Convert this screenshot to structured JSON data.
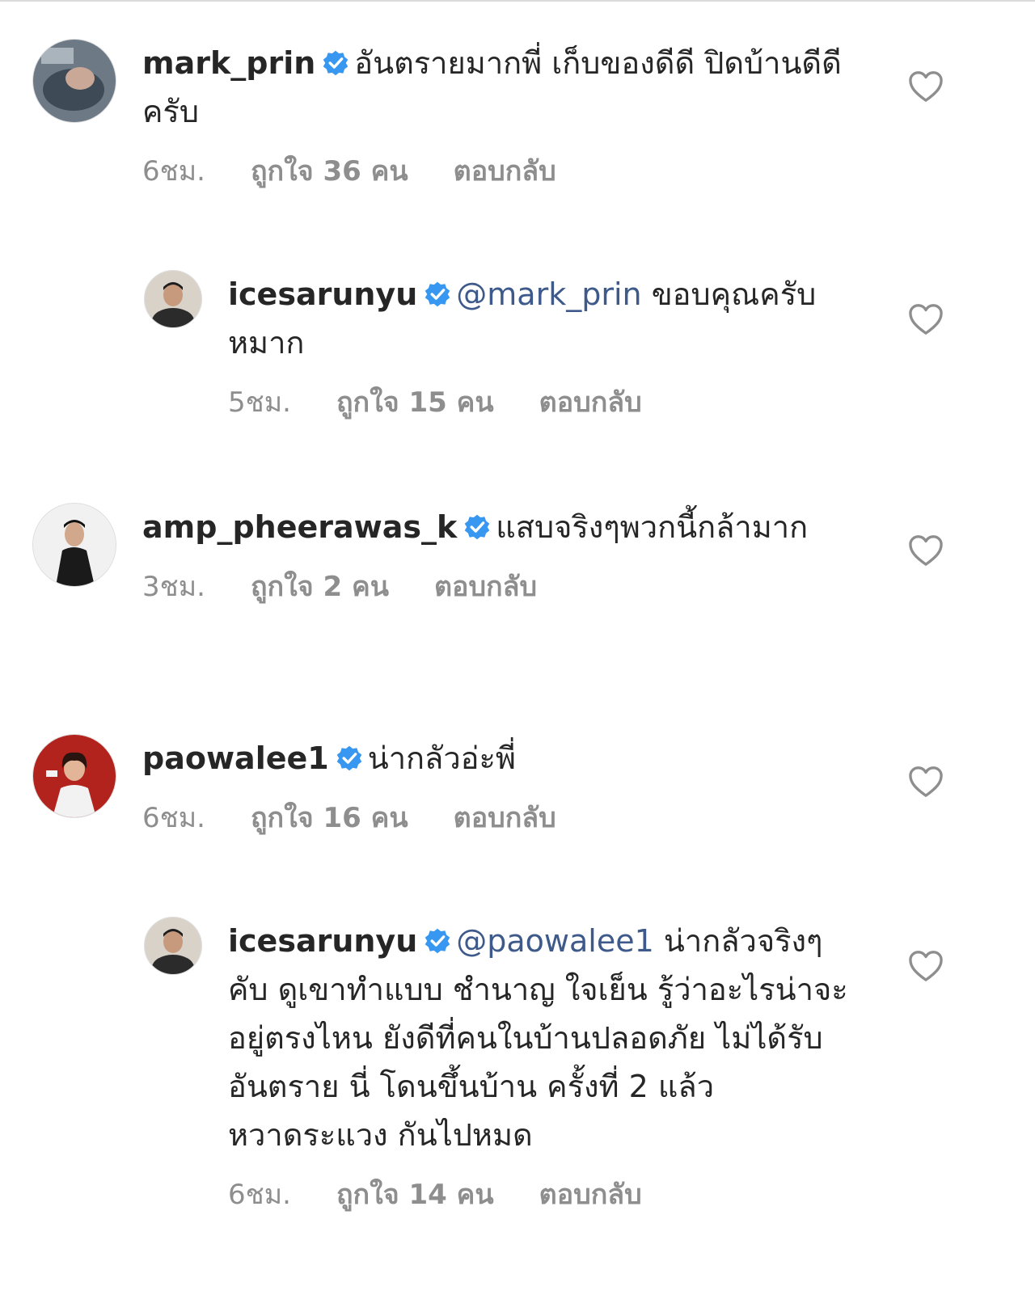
{
  "comments": [
    {
      "username": "mark_prin",
      "mention": "",
      "text": "อันตรายมากพี่ เก็บของดีดี ปิดบ้านดีดี ครับ",
      "time": "6ชม.",
      "likes": "ถูกใจ 36 คน",
      "reply": "ตอบกลับ"
    },
    {
      "username": "icesarunyu",
      "mention": "@mark_prin",
      "text": "ขอบคุณครับหมาก",
      "time": "5ชม.",
      "likes": "ถูกใจ 15 คน",
      "reply": "ตอบกลับ"
    },
    {
      "username": "amp_pheerawas_k",
      "mention": "",
      "text": "แสบจริงๆพวกนี้กล้ามาก",
      "time": "3ชม.",
      "likes": "ถูกใจ 2 คน",
      "reply": "ตอบกลับ"
    },
    {
      "username": "paowalee1",
      "mention": "",
      "text": "น่ากลัวอ่ะพี่",
      "time": "6ชม.",
      "likes": "ถูกใจ 16 คน",
      "reply": "ตอบกลับ"
    },
    {
      "username": "icesarunyu",
      "mention": "@paowalee1",
      "text": "น่ากลัวจริงๆคับ ดูเขาทำแบบ ชำนาญ ใจเย็น รู้ว่าอะไรน่าจะอยู่ตรงไหน  ยังดีที่คนในบ้านปลอดภัย ไม่ได้รับอันตราย  นี่ โดนขึ้นบ้าน ครั้งที่ 2 แล้ว หวาดระแวง กันไปหมด",
      "time": "6ชม.",
      "likes": "ถูกใจ 14 คน",
      "reply": "ตอบกลับ"
    }
  ],
  "icons": {
    "verified": "verified-badge-icon",
    "like": "heart-outline-icon"
  },
  "colors": {
    "verified": "#3897f0",
    "mention": "#3d5a8a",
    "meta": "#8e8e8e",
    "text": "#262626"
  }
}
